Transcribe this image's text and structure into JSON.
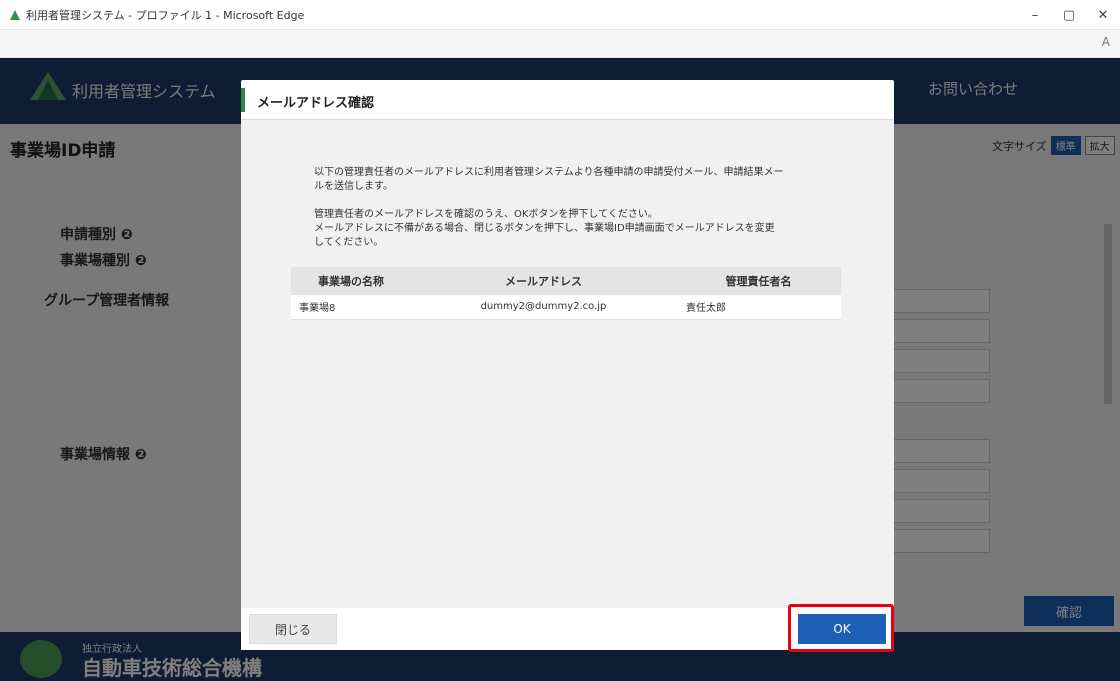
{
  "browser": {
    "window_title": "利用者管理システム - プロファイル 1 - Microsoft Edge",
    "minimize": "–",
    "maximize": "▢",
    "close": "✕",
    "read_aloud": "A"
  },
  "site": {
    "brand": "利用者管理システム",
    "contact": "お問い合わせ"
  },
  "page": {
    "title": "事業場ID申請",
    "font_size_label": "文字サイズ",
    "font_size_standard": "標準",
    "font_size_large": "拡大",
    "labels": {
      "application_type": "申請種別 ❷",
      "site_type": "事業場種別 ❷",
      "group_admin_info": "グループ管理者情報",
      "site_info": "事業場情報 ❷"
    },
    "confirm_button": "確認"
  },
  "footer": {
    "sub": "独立行政法人",
    "org": "自動車技術総合機構"
  },
  "modal": {
    "title": "メールアドレス確認",
    "message1": "以下の管理責任者のメールアドレスに利用者管理システムより各種申請の申請受付メール、申請結果メールを送信します。",
    "message2": "管理責任者のメールアドレスを確認のうえ、OKボタンを押下してください。",
    "message3": "メールアドレスに不備がある場合、閉じるボタンを押下し、事業場ID申請画面でメールアドレスを変更してください。",
    "table": {
      "headers": [
        "事業場の名称",
        "メールアドレス",
        "管理責任者名"
      ],
      "rows": [
        [
          "事業場8",
          "dummy2@dummy2.co.jp",
          "責任太郎"
        ]
      ]
    },
    "close_button": "閉じる",
    "ok_button": "OK"
  },
  "colors": {
    "header_navy": "#1c3a67",
    "accent_green": "#2f8a3f",
    "primary_blue": "#1c5fb5",
    "highlight_red": "#e60012"
  }
}
